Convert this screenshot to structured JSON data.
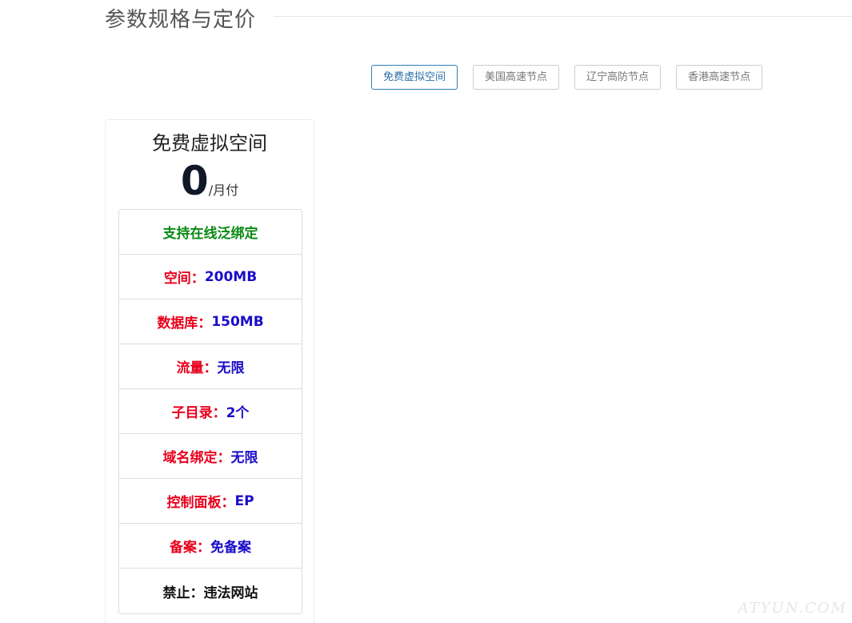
{
  "section": {
    "title": "参数规格与定价"
  },
  "tabs": [
    {
      "label": "免费虚拟空间",
      "active": true
    },
    {
      "label": "美国高速节点",
      "active": false
    },
    {
      "label": "辽宁高防节点",
      "active": false
    },
    {
      "label": "香港高速节点",
      "active": false
    }
  ],
  "plan": {
    "name": "免费虚拟空间",
    "price": "0",
    "price_unit": "/月付",
    "features": [
      {
        "label": "支持在线泛绑定",
        "value": ""
      },
      {
        "label": "空间：",
        "value": "200MB"
      },
      {
        "label": "数据库：",
        "value": "150MB"
      },
      {
        "label": "流量：",
        "value": "无限"
      },
      {
        "label": "子目录：",
        "value": "2个"
      },
      {
        "label": "域名绑定：",
        "value": "无限"
      },
      {
        "label": "控制面板：",
        "value": "EP"
      },
      {
        "label": "备案：",
        "value": "免备案"
      },
      {
        "label": "禁止：",
        "value": "违法网站"
      }
    ]
  },
  "watermark": "ATYUN.COM",
  "colors": {
    "accent": "#2c7fb8",
    "feature_label": "#e8001c",
    "feature_value": "#1a0dc9",
    "feature_highlight": "#0a8a14"
  }
}
